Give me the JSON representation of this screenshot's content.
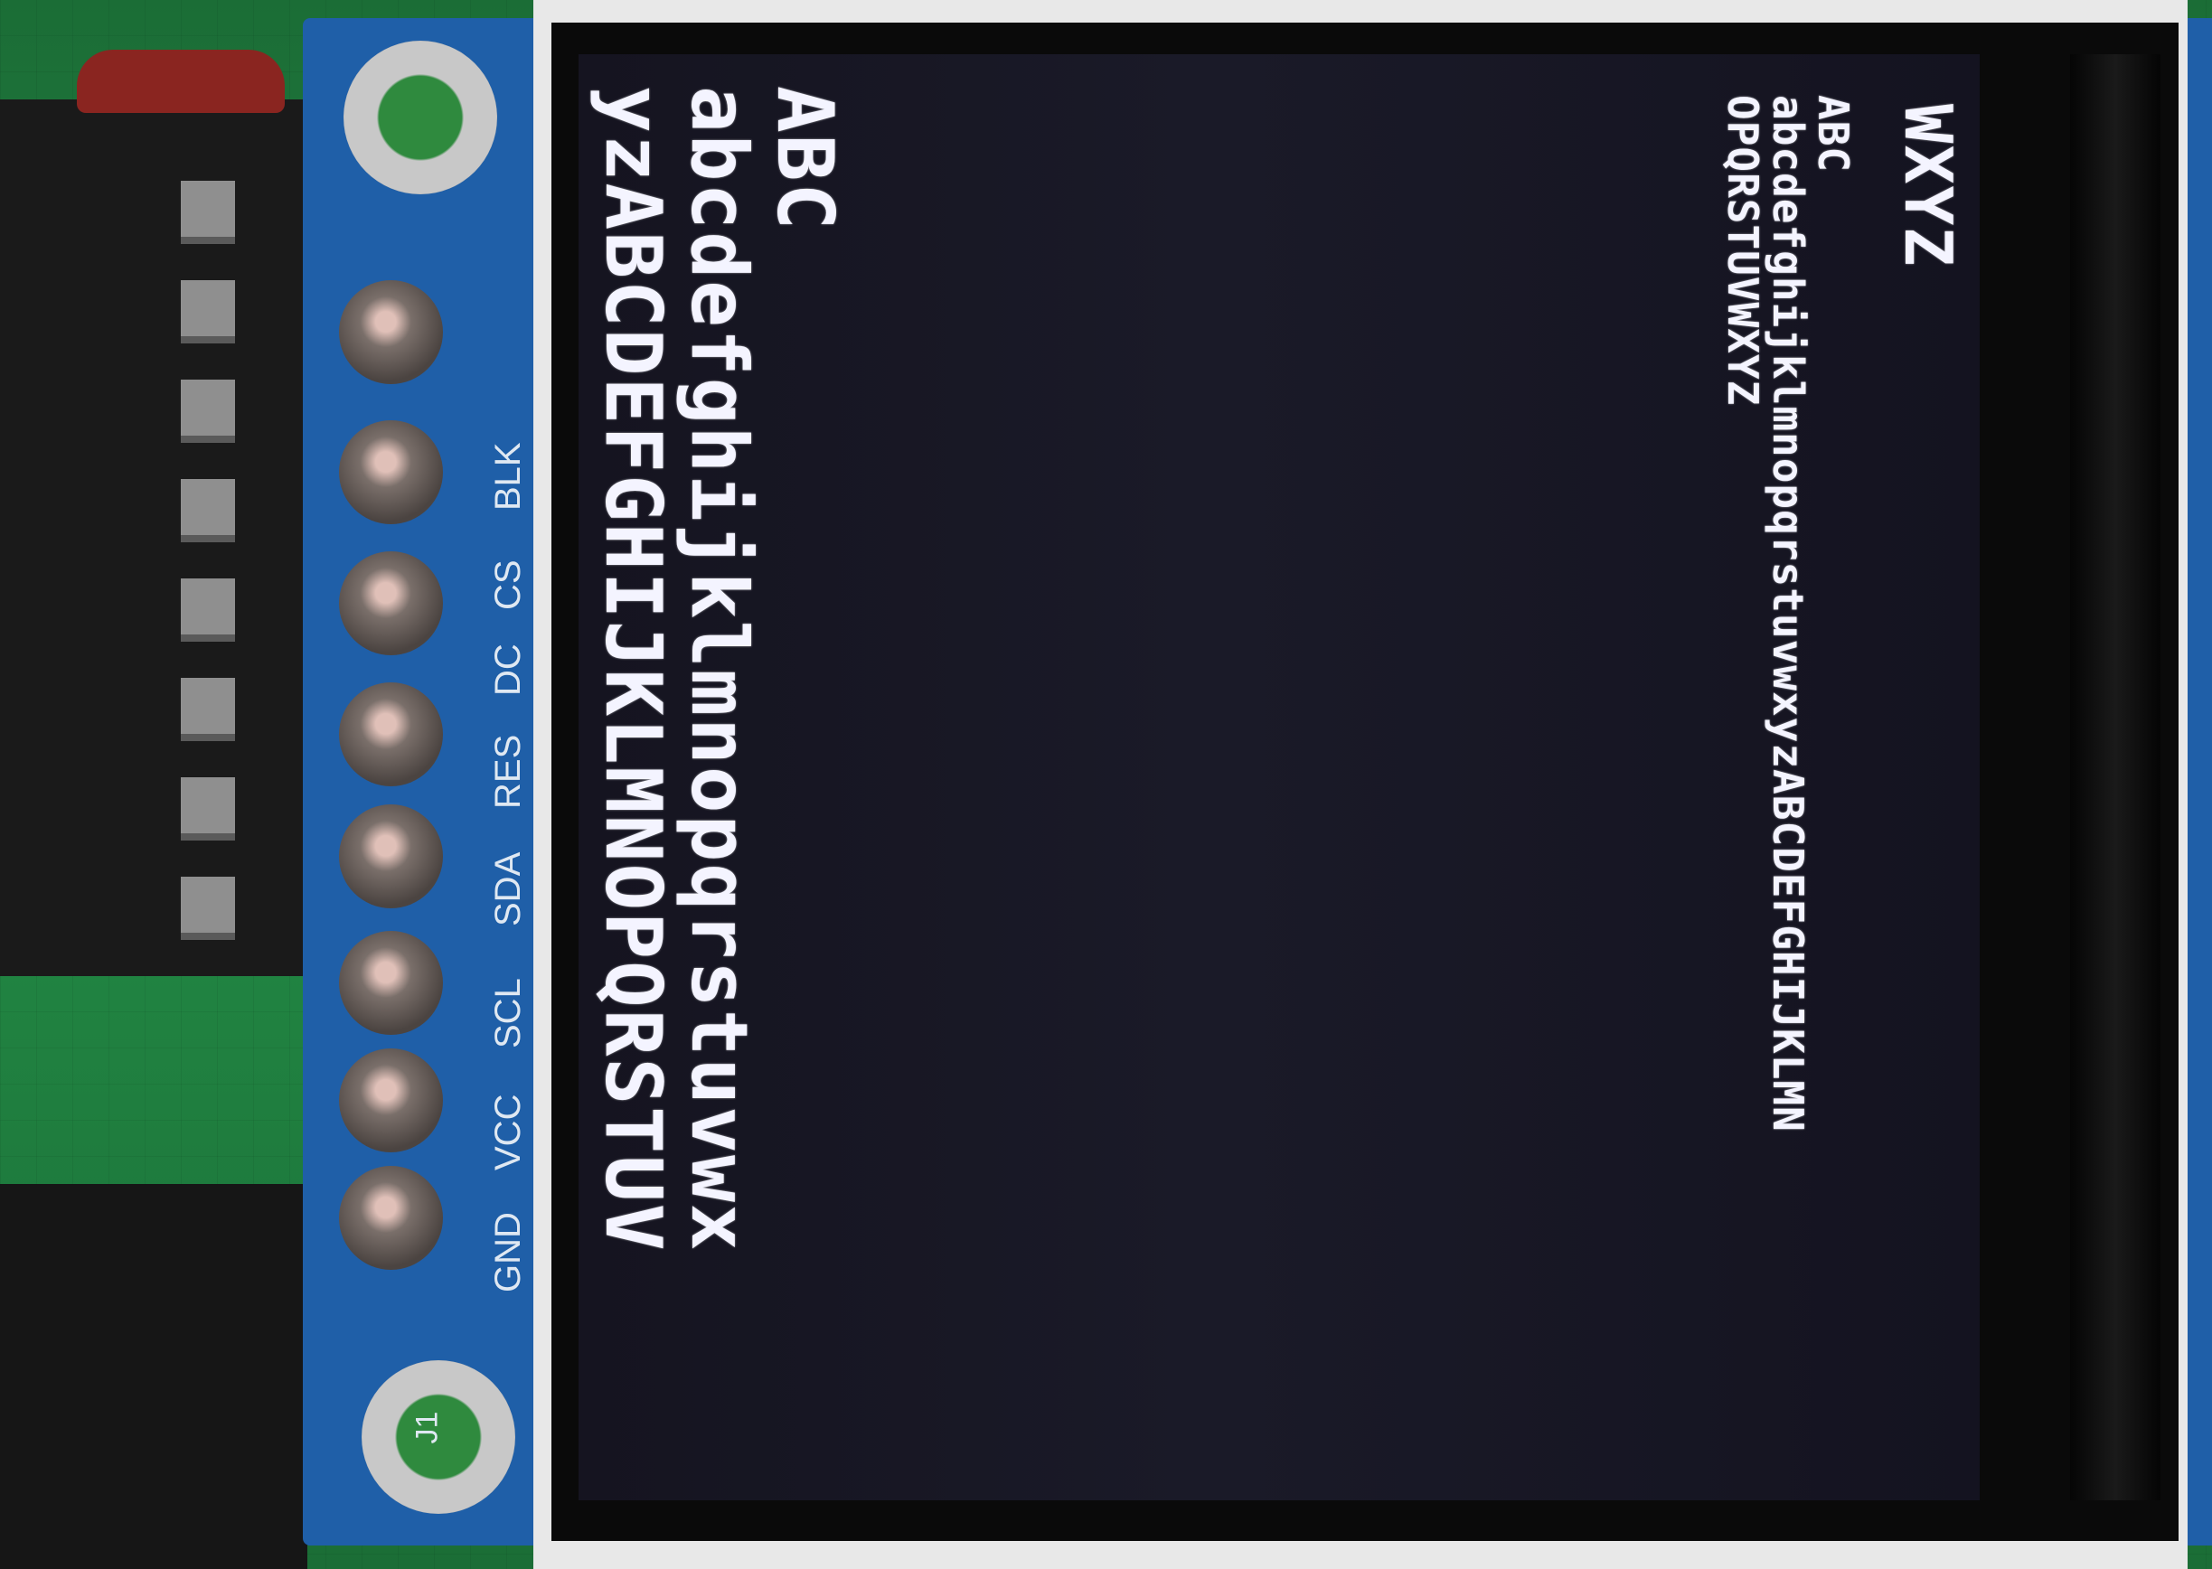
{
  "board": {
    "pin_labels": [
      "GND",
      "VCC",
      "SCL",
      "SDA",
      "RES",
      "DC",
      "CS",
      "BLK"
    ],
    "connector_label": "J1"
  },
  "display": {
    "large_lines": [
      "ABC",
      "abcdefghijklmnopqrstuvwx",
      "yzABCDEFGHIJKLMNOPQRSTUV"
    ],
    "small_lines": [
      "ABC",
      "abcdefghijklmnopqrstuvwxyzABCDEFGHIJKLMN",
      "OPQRSTUVWXYZ"
    ],
    "corner_line": "WXYZ"
  }
}
